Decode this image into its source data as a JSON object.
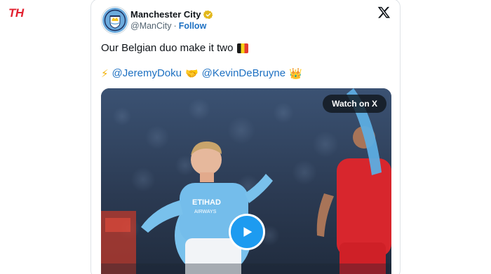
{
  "site": {
    "logo_text": "TH",
    "brand_color": "#e2202f"
  },
  "tweet": {
    "author": {
      "name": "Manchester City",
      "handle": "@ManCity",
      "separator": "·",
      "follow_label": "Follow",
      "verified_badge_icon": "gold-checkmark-badge",
      "verified_color": "#e2b719"
    },
    "platform_icon": "x-logo-icon",
    "text": "Our Belgian duo make it two",
    "text_emoji_icon": "belgium-flag",
    "mentions": [
      {
        "icon": "high-voltage",
        "glyph": "⚡",
        "handle": "@JeremyDoku"
      },
      {
        "icon": "handshake",
        "glyph": "🤝",
        "handle": "@KevinDeBruyne"
      }
    ],
    "trailing_emoji": {
      "icon": "crown",
      "glyph": "👑"
    },
    "link_color": "#1d70c2",
    "media": {
      "type": "video",
      "watch_label": "Watch on X",
      "play_icon": "play-icon",
      "play_color": "#1d9bf0"
    }
  }
}
